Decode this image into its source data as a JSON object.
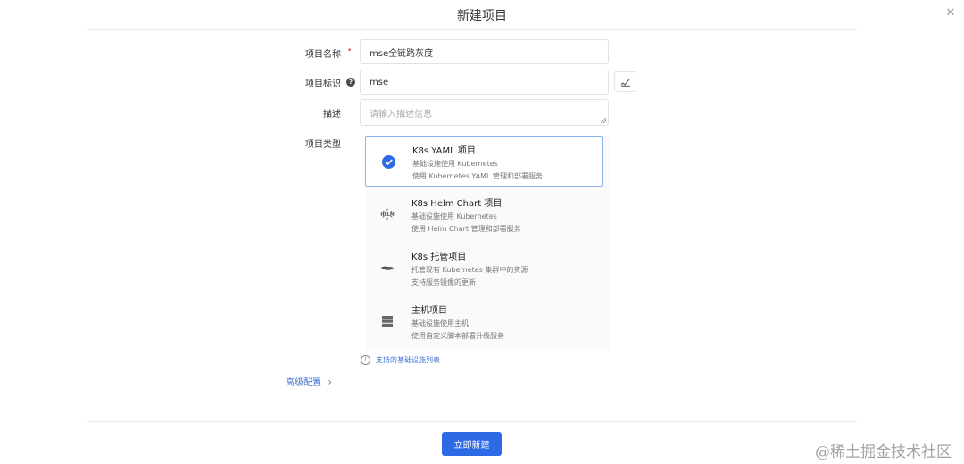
{
  "modal": {
    "title": "新建项目",
    "close_glyph": "✕"
  },
  "form": {
    "name_label": "项目名称",
    "name_required_mark": "•",
    "name_value": "mse全链路灰度",
    "key_label": "项目标识",
    "key_help_glyph": "?",
    "key_value": "mse",
    "generate_key_icon": "edit-icon",
    "desc_label": "描述",
    "desc_placeholder": "请输入描述信息",
    "type_label": "项目类型"
  },
  "project_types": [
    {
      "title": "K8s YAML 项目",
      "desc1": "基础设施使用 Kubernetes",
      "desc2": "使用 Kubernetes YAML 管理和部署服务",
      "icon": "check-circle-icon",
      "selected": true
    },
    {
      "title": "K8s Helm Chart 项目",
      "desc1": "基础设施使用 Kubernetes",
      "desc2": "使用 Helm Chart 管理和部署服务",
      "icon": "helm-icon",
      "icon_text": "HELM",
      "selected": false
    },
    {
      "title": "K8s 托管项目",
      "desc1": "托管现有 Kubernetes 集群中的资源",
      "desc2": "支持服务镜像的更新",
      "icon": "hand-icon",
      "selected": false
    },
    {
      "title": "主机项目",
      "desc1": "基础设施使用主机",
      "desc2": "使用自定义脚本部署升级服务",
      "icon": "server-icon",
      "selected": false
    }
  ],
  "supported_link": {
    "icon_glyph": "!",
    "text": "支持的基础设施列表"
  },
  "advanced": {
    "label": "高级配置",
    "chevron": "›"
  },
  "footer": {
    "submit_label": "立即新建"
  },
  "watermark": "@稀土掘金技术社区",
  "colors": {
    "primary": "#2d6be6",
    "link": "#3b6fd4",
    "selected_border": "#8fb0ee",
    "required": "#e5484d"
  }
}
